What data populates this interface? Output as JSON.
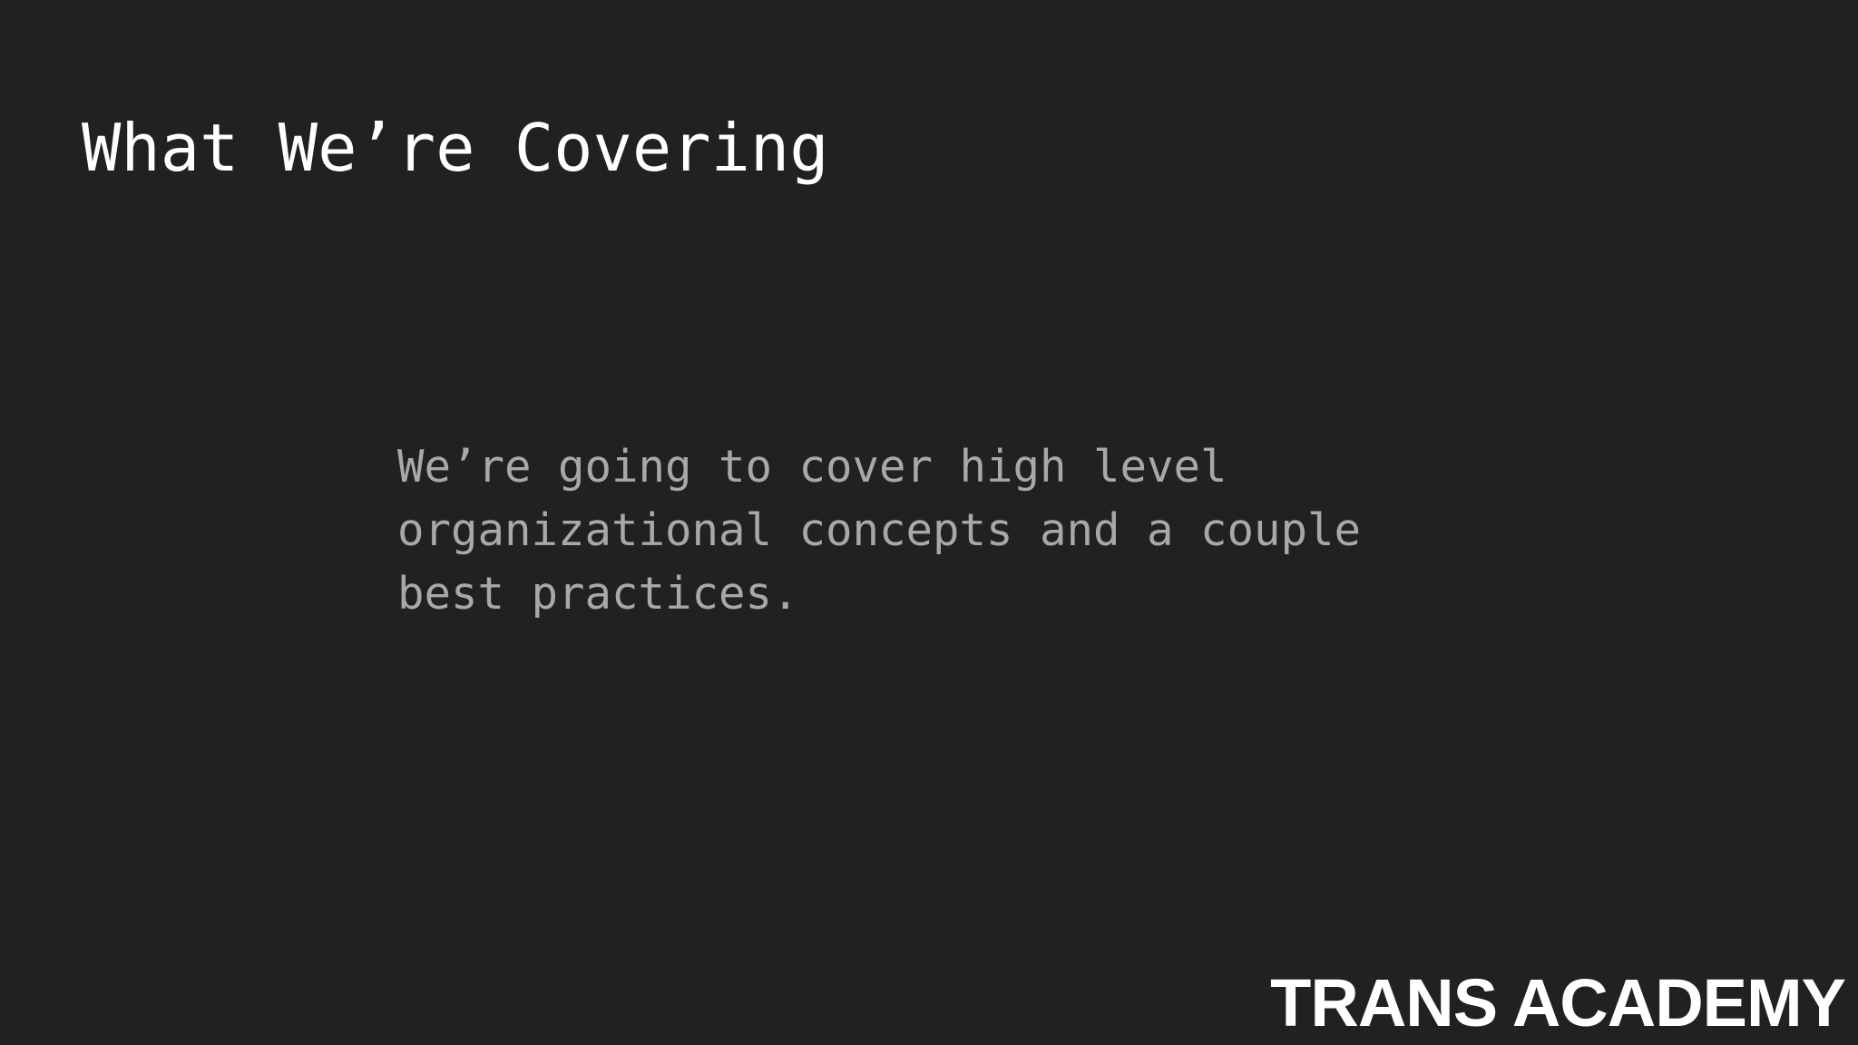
{
  "slide": {
    "title": "What We’re Covering",
    "body_lines": [
      "We’re going to cover high level",
      "organizational concepts and a couple",
      "best practices."
    ],
    "logo_text": "TRANS ACADEMY"
  },
  "colors": {
    "background": "#212121",
    "title": "#ffffff",
    "body": "#a8a8a8",
    "logo": "#ffffff"
  }
}
